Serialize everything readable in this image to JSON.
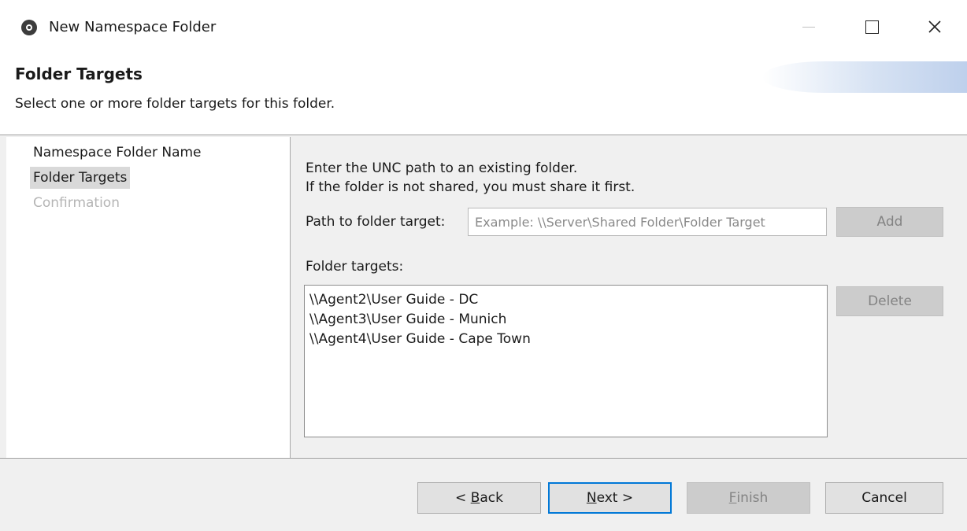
{
  "window": {
    "title": "New Namespace Folder"
  },
  "header": {
    "title": "Folder Targets",
    "subtitle": "Select one or more folder targets for this folder."
  },
  "steps": [
    {
      "label": "Namespace Folder Name",
      "state": "done"
    },
    {
      "label": "Folder Targets",
      "state": "current"
    },
    {
      "label": "Confirmation",
      "state": "disabled"
    }
  ],
  "main": {
    "instruction_line1": "Enter the UNC path to an existing folder.",
    "instruction_line2": "If the folder is not shared, you must share it first.",
    "path_label": "Path to folder target:",
    "path_value": "",
    "path_placeholder": "Example: \\\\Server\\Shared Folder\\Folder Target",
    "add_label": "Add",
    "targets_label": "Folder targets:",
    "targets": [
      "\\\\Agent2\\User Guide - DC",
      "\\\\Agent3\\User Guide - Munich",
      "\\\\Agent4\\User Guide - Cape Town"
    ],
    "delete_label": "Delete"
  },
  "footer": {
    "back_prefix": "< ",
    "back_mnemonic": "B",
    "back_rest": "ack",
    "next_mnemonic": "N",
    "next_rest": "ext >",
    "finish_mnemonic": "F",
    "finish_rest": "inish",
    "cancel_label": "Cancel"
  },
  "icons": {
    "app": "peer-app-icon",
    "minimize": "minimize-icon",
    "maximize": "maximize-icon",
    "close": "close-icon"
  },
  "colors": {
    "accent": "#0078d7",
    "selected_step_bg": "#d9d9d9",
    "disabled_text": "#838383",
    "panel_bg": "#f0f0f0"
  }
}
